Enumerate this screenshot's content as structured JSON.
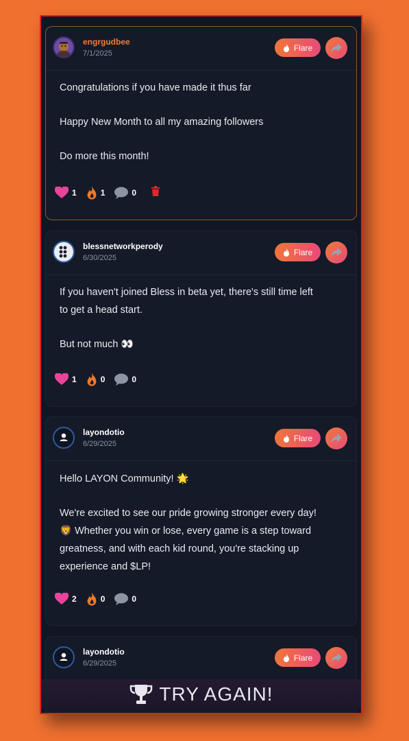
{
  "posts": [
    {
      "username": "engrgudbee",
      "date": "7/1/2025",
      "lines": [
        "Congratulations if you have made it thus far",
        "Happy New Month to all my amazing followers",
        "Do more this month!"
      ],
      "likes": "1",
      "flares": "1",
      "comments": "0",
      "flare_label": "Flare"
    },
    {
      "username": "blessnetworkperody",
      "date": "6/30/2025",
      "line1a": "If you haven't joined Bless in beta yet, there's still time left",
      "line1b": "to get a head start.",
      "line2": "But not much 👀",
      "likes": "1",
      "flares": "0",
      "comments": "0",
      "flare_label": "Flare"
    },
    {
      "username": "layondotio",
      "date": "6/29/2025",
      "line1": "Hello LAYON Community! 🌟",
      "line2a": "We're excited to see our pride growing stronger every day!",
      "line2b": "🦁 Whether you win or lose, every game is a step toward",
      "line2c": "greatness, and with each kid round, you're stacking up",
      "line2d": "experience and $LP!",
      "likes": "2",
      "flares": "0",
      "comments": "0",
      "flare_label": "Flare"
    },
    {
      "username": "layondotio",
      "date": "6/29/2025",
      "flare_label": "Flare"
    }
  ],
  "banner": {
    "text": "TRY AGAIN!"
  },
  "colors": {
    "background": "#f07030",
    "card": "#141a27",
    "accent_orange": "#f37b3a",
    "accent_pink": "#e84a78",
    "heart": "#e8449a",
    "trash": "#e0262a"
  },
  "icons": [
    "heart-icon",
    "flame-icon",
    "comment-icon",
    "trash-icon",
    "share-icon",
    "trophy-icon",
    "user-icon"
  ]
}
